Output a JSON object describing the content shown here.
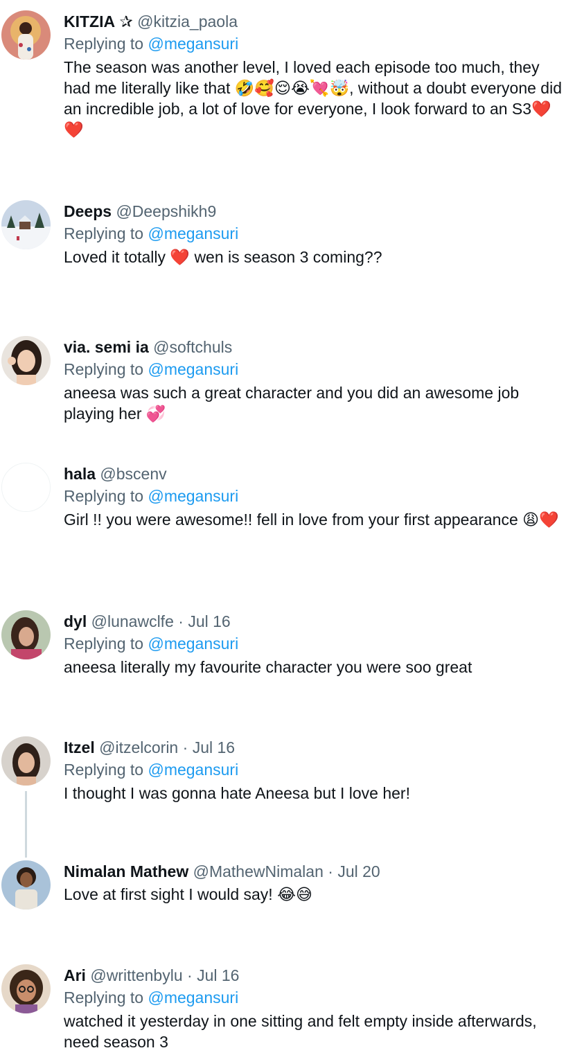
{
  "reply_prefix": "Replying to ",
  "tweets": [
    {
      "name": "KITZIA",
      "name_symbol": "✰",
      "handle": "@kitzia_paola",
      "replying_to": "@megansuri",
      "text": "The season was another level, I loved each episode too much, they had me literally like that 🤣🥰😌😭💘🤯, without a doubt everyone did an incredible job, a lot of love for everyone, I look forward to an S3❤️❤️"
    },
    {
      "name": "Deeps",
      "handle": "@Deepshikh9",
      "replying_to": "@megansuri",
      "text": "Loved it totally ❤️ wen is season 3 coming??"
    },
    {
      "name": "via. semi ia",
      "handle": "@softchuls",
      "replying_to": "@megansuri",
      "text": "aneesa was such a great character and you did an awesome job playing her 💞"
    },
    {
      "name": "hala",
      "handle": "@bscenv",
      "replying_to": "@megansuri",
      "text": "Girl !! you were awesome!! fell in love from your first appearance 😩❤️"
    },
    {
      "name": "dyl",
      "handle": "@lunawclfe",
      "date": "Jul 16",
      "replying_to": "@megansuri",
      "text": "aneesa literally my favourite character you were soo great"
    },
    {
      "name": "Itzel",
      "handle": "@itzelcorin",
      "date": "Jul 16",
      "replying_to": "@megansuri",
      "text": "I thought I was gonna hate Aneesa but I love her!"
    },
    {
      "name": "Nimalan Mathew",
      "handle": "@MathewNimalan",
      "date": "Jul 20",
      "text": "Love at first sight I would say! 😂😅"
    },
    {
      "name": "Ari",
      "handle": "@writtenbylu",
      "date": "Jul 16",
      "replying_to": "@megansuri",
      "text": "watched it yesterday in one sitting and felt empty inside afterwards, need season 3"
    }
  ],
  "separator": "·",
  "colors": {
    "text": "#0f1419",
    "secondary": "#536471",
    "link": "#1d9bf0",
    "thread_line": "#cfd9de"
  }
}
